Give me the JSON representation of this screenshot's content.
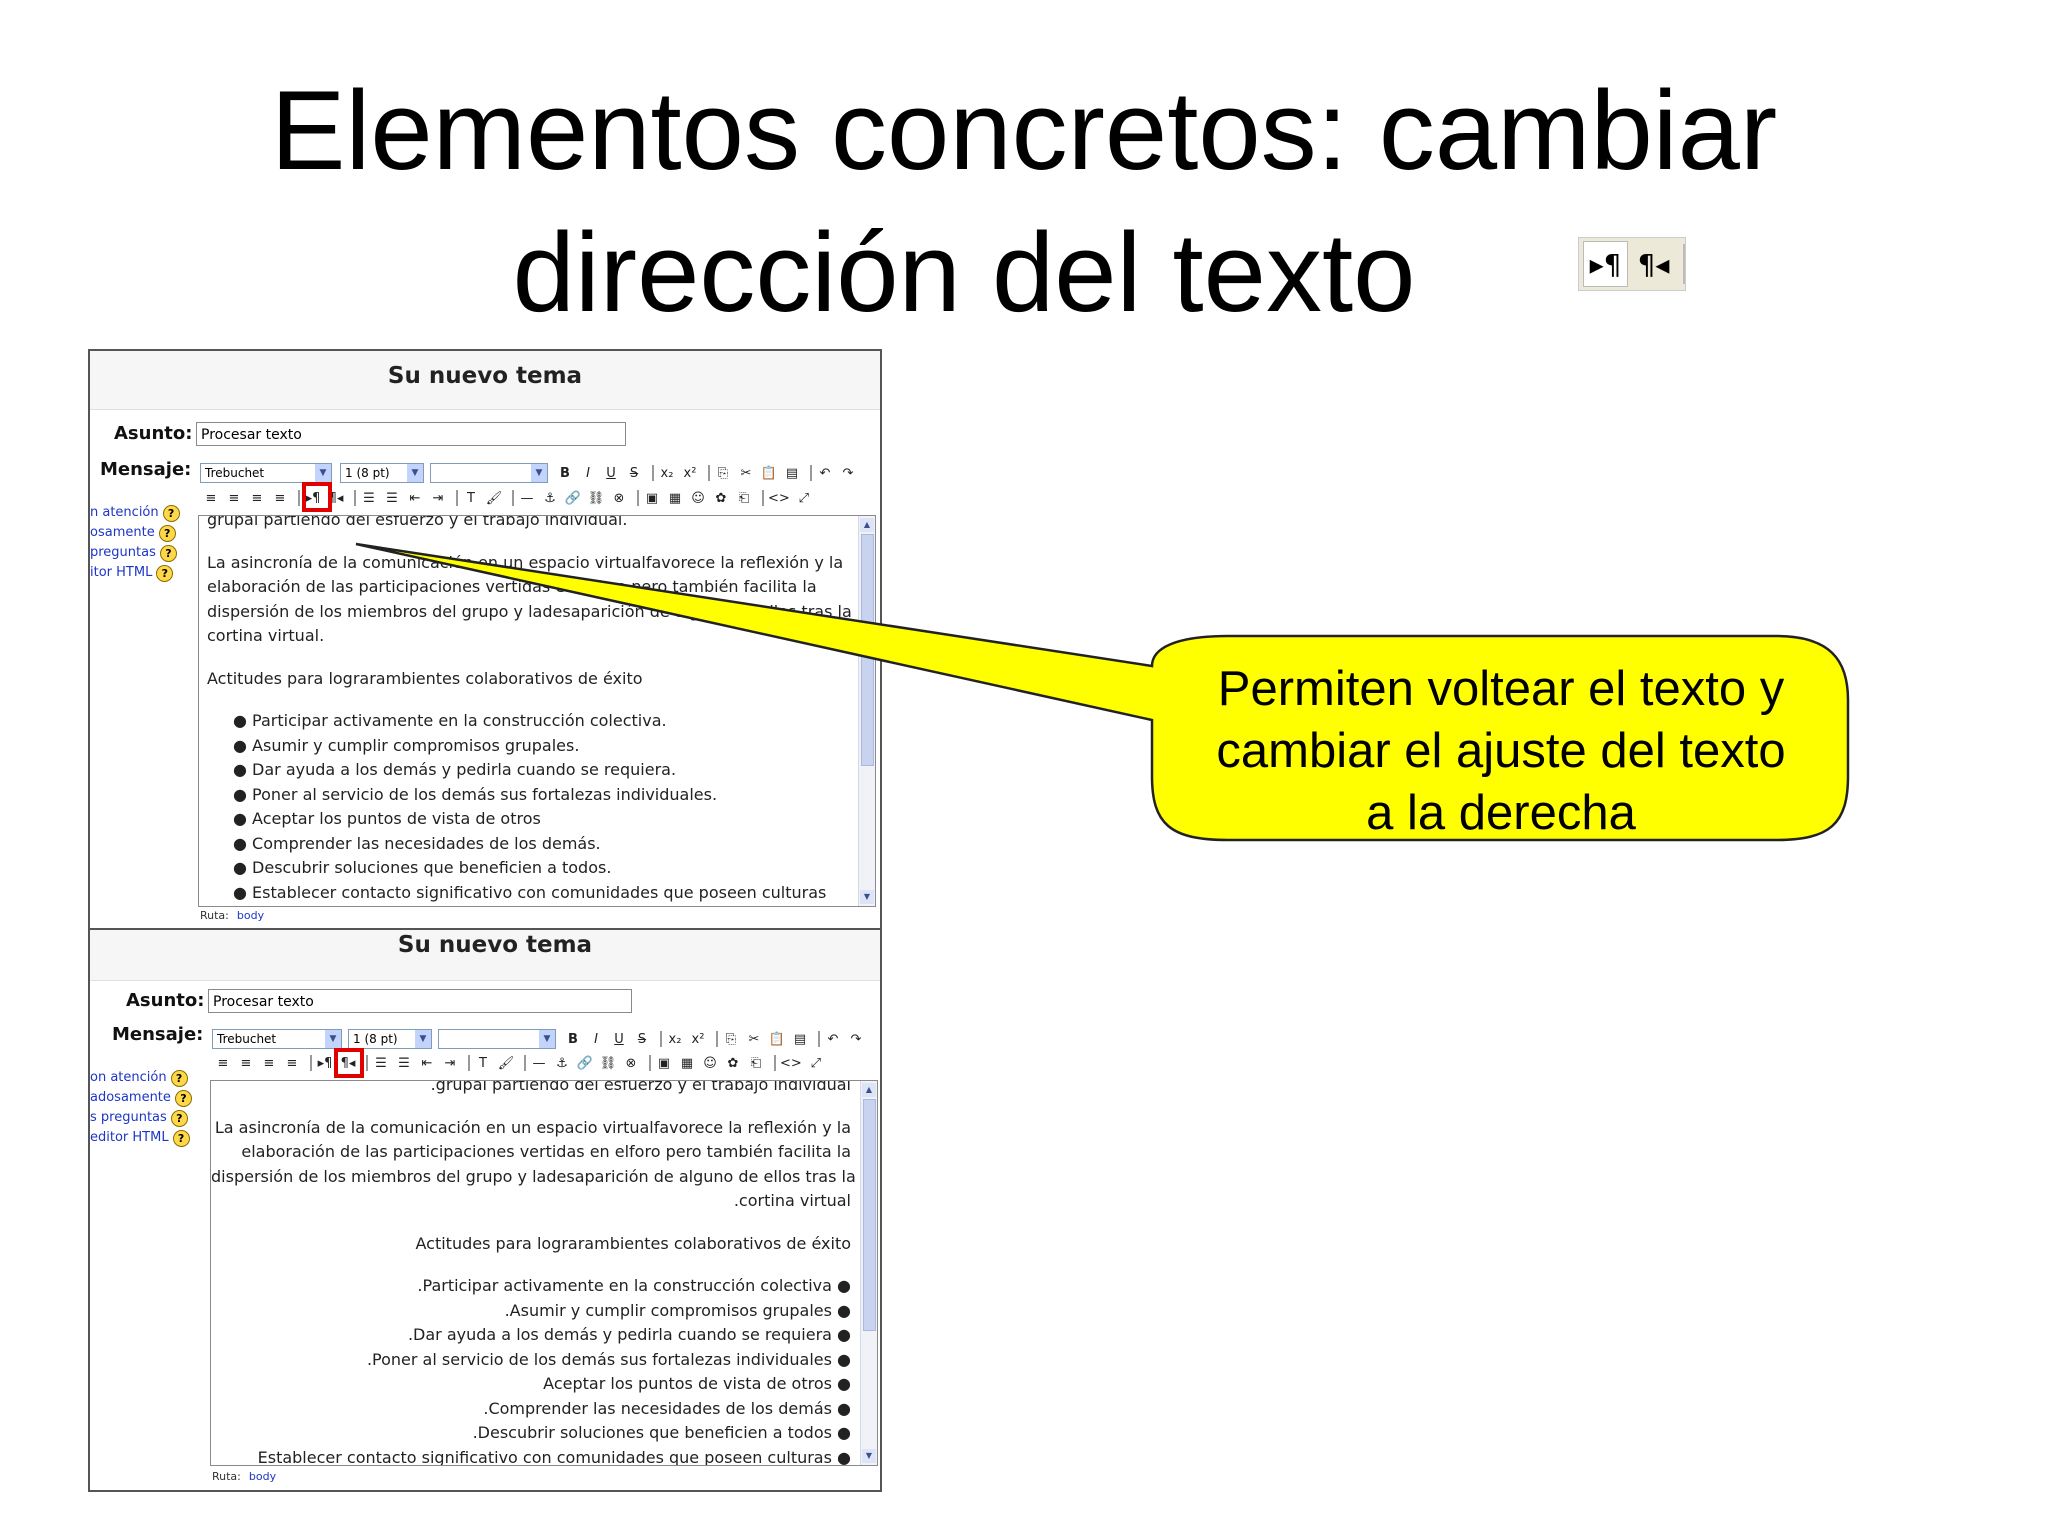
{
  "slide": {
    "title_line1": "Elementos concretos: cambiar",
    "title_line2": "dirección del texto",
    "callout_line1": "Permiten voltear el texto y",
    "callout_line2": "cambiar el ajuste del texto",
    "callout_line3": "a la derecha"
  },
  "direction_icons": {
    "ltr": "▸¶",
    "rtl": "¶◂"
  },
  "panel": {
    "title": "Su nuevo tema",
    "subject_label": "Asunto:",
    "subject_value": "Procesar texto",
    "message_label": "Mensaje:",
    "font_value": "Trebuchet",
    "size_value": "1 (8 pt)",
    "format_value": "",
    "toolbar1": [
      "B",
      "I",
      "U",
      "S",
      "x₂",
      "x²",
      "⎘",
      "✂",
      "📋",
      "▤",
      "↶",
      "↷"
    ],
    "toolbar2_align": [
      "≡",
      "≡",
      "≡",
      "≡"
    ],
    "toolbar2_rest": [
      "☰",
      "☰",
      "⇤",
      "⇥",
      "T",
      "🖌",
      "—",
      "⚓",
      "🔗",
      "⛓",
      "⊗",
      "▣",
      "▦",
      "☺",
      "✿",
      "⎗",
      "<>",
      "⤢"
    ],
    "side_links_top": [
      "n atención",
      "osamente",
      "preguntas",
      "itor HTML"
    ],
    "side_links_bottom": [
      "on atención",
      "adosamente",
      "s preguntas",
      "editor HTML"
    ],
    "help_icon": "?",
    "ruta_label": "Ruta:",
    "ruta_value": "body"
  },
  "editor_ltr": {
    "cut_line": "grupal partiendo del esfuerzo y el trabajo individual.",
    "para_lines": [
      "La asincronía de la comunicación en un espacio virtualfavorece la reflexión y la",
      "elaboración de las participaciones vertidas en elforo pero también facilita la",
      "dispersión de los miembros del grupo y ladesaparición de alguno de ellos tras la",
      "cortina virtual."
    ],
    "heading": "Actitudes para lograrambientes colaborativos de éxito",
    "bullets": [
      "Participar activamente en la construcción colectiva.",
      "Asumir y cumplir compromisos grupales.",
      "Dar ayuda a los demás y pedirla cuando se requiera.",
      "Poner al servicio de los demás sus fortalezas individuales.",
      "Aceptar los puntos de vista de otros",
      "Comprender las necesidades de los demás.",
      "Descubrir soluciones que beneficien a todos.",
      "Establecer contacto significativo con comunidades que poseen culturas"
    ]
  },
  "editor_rtl": {
    "cut_line": ".grupal partiendo del esfuerzo y el trabajo individual",
    "para_lines": [
      "La asincronía de la comunicación en un espacio virtualfavorece la reflexión y la",
      "elaboración de las participaciones vertidas en elforo pero también facilita la",
      "dispersión de los miembros del grupo y ladesaparición de alguno de ellos tras la",
      ".cortina virtual"
    ],
    "heading": "Actitudes para lograrambientes colaborativos de éxito",
    "bullets": [
      ".Participar activamente en la construcción colectiva",
      ".Asumir y cumplir compromisos grupales",
      ".Dar ayuda a los demás y pedirla cuando se requiera",
      ".Poner al servicio de los demás sus fortalezas individuales",
      "Aceptar los puntos de vista de otros",
      ".Comprender las necesidades de los demás",
      ".Descubrir soluciones que beneficien a todos",
      "Establecer contacto significativo con comunidades que poseen culturas"
    ]
  },
  "colors": {
    "callout_fill": "#ffff00",
    "highlight": "#e00000",
    "link": "#1d35c8"
  }
}
